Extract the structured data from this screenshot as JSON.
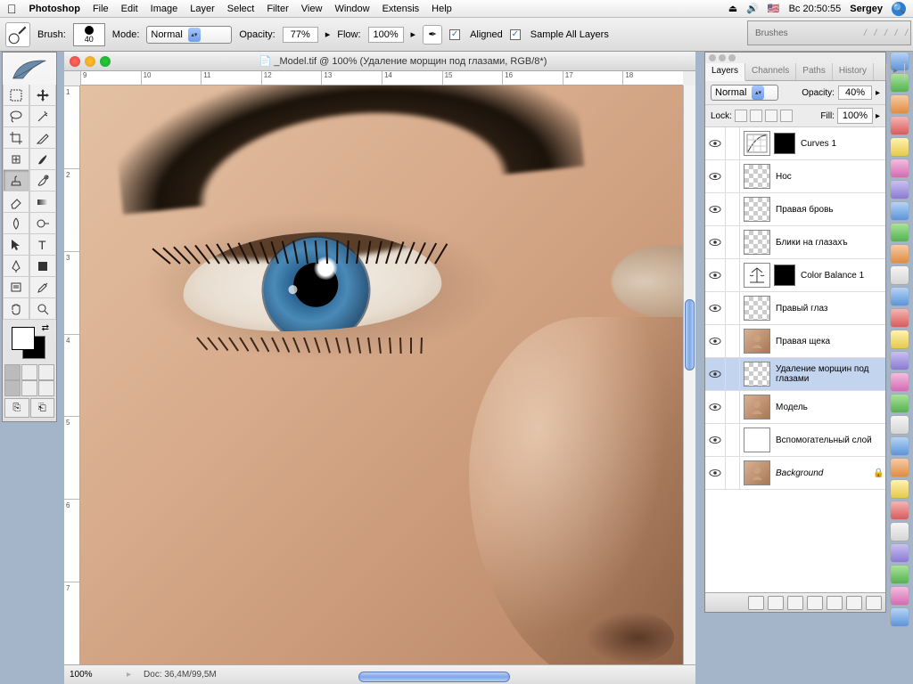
{
  "menubar": {
    "app": "Photoshop",
    "items": [
      "File",
      "Edit",
      "Image",
      "Layer",
      "Select",
      "Filter",
      "View",
      "Window",
      "Extensis",
      "Help"
    ],
    "eject_icon": "⏏",
    "volume_icon": "🔊",
    "flag": "🇺🇸",
    "clock": "Вс 20:50:55",
    "user": "Sergey"
  },
  "options": {
    "brush_label": "Brush:",
    "brush_size": "40",
    "mode_label": "Mode:",
    "mode_value": "Normal",
    "opacity_label": "Opacity:",
    "opacity_value": "77%",
    "flow_label": "Flow:",
    "flow_value": "100%",
    "aligned_label": "Aligned",
    "sample_all_label": "Sample All Layers"
  },
  "brushes_tab": "Brushes",
  "document": {
    "title": "_Model.tif @ 100% (Удаление морщин под глазами, RGB/8*)",
    "ruler_h": [
      "9",
      "10",
      "11",
      "12",
      "13",
      "14",
      "15",
      "16",
      "17",
      "18"
    ],
    "ruler_v": [
      "1",
      "2",
      "3",
      "4",
      "5",
      "6",
      "7"
    ],
    "zoom": "100%",
    "docinfo": "Doc: 36,4M/99,5M"
  },
  "layers_panel": {
    "tabs": [
      "Layers",
      "Channels",
      "Paths",
      "History"
    ],
    "blend_mode": "Normal",
    "opacity_label": "Opacity:",
    "opacity_value": "40%",
    "lock_label": "Lock:",
    "fill_label": "Fill:",
    "fill_value": "100%",
    "layers": [
      {
        "name": "Curves 1",
        "thumb": "curves",
        "mask": true
      },
      {
        "name": "Нос",
        "thumb": "checker"
      },
      {
        "name": "Правая бровь",
        "thumb": "checker"
      },
      {
        "name": "Блики на глазахъ",
        "thumb": "checker"
      },
      {
        "name": "Color Balance 1",
        "thumb": "balance",
        "mask": true
      },
      {
        "name": "Правый глаз",
        "thumb": "checker"
      },
      {
        "name": "Правая щека",
        "thumb": "photo"
      },
      {
        "name": "Удаление морщин под глазами",
        "thumb": "checker",
        "selected": true
      },
      {
        "name": "Модель",
        "thumb": "photo"
      },
      {
        "name": "Вспомогательный слой",
        "thumb": "white"
      },
      {
        "name": "Background",
        "thumb": "photo",
        "italic": true,
        "locked": true
      }
    ]
  }
}
